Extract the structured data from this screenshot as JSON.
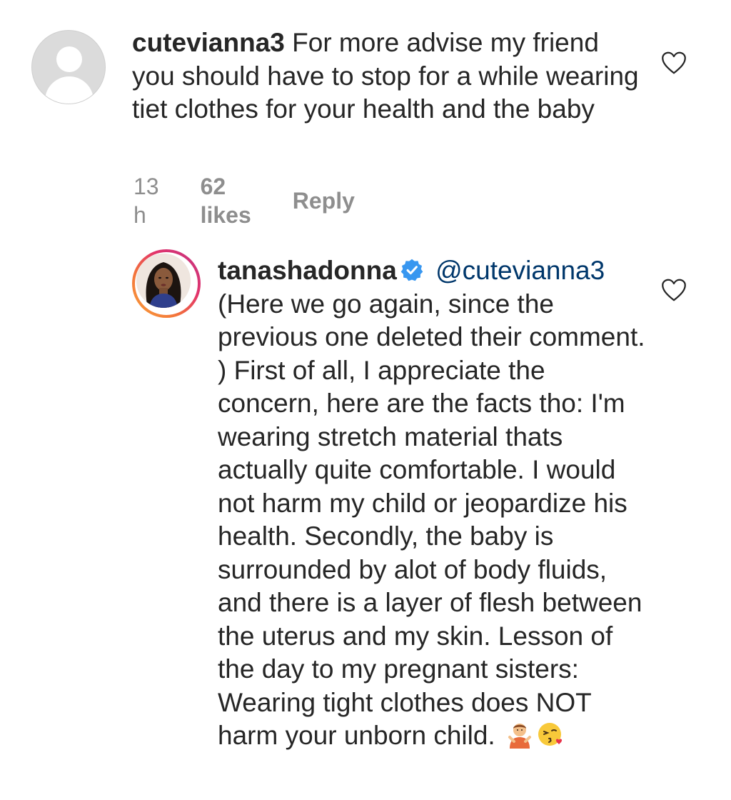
{
  "comments": [
    {
      "username": "cutevianna3",
      "text": "For more advise my friend you should have to stop for a while wearing tiet clothes for your health and the baby",
      "time": "13 h",
      "likes": "62 likes",
      "reply_label": "Reply"
    },
    {
      "username": "tanashadonna",
      "verified": true,
      "mention": "@cutevianna3",
      "text": "(Here we go again, since the previous one deleted their comment. ) First of all, I appreciate the concern, here are the facts tho: I'm wearing stretch material thats actually quite comfortable. I would not harm my child or jeopardize his health. Secondly, the baby is surrounded by alot of body fluids, and there is a layer of flesh between the uterus and my skin. Lesson of the day to my pregnant sisters: Wearing tight clothes does NOT harm your unborn child.",
      "emojis": [
        "person-gesturing-ok-emoji",
        "face-blowing-kiss-emoji"
      ]
    }
  ],
  "icons": {
    "like": "heart-outline-icon",
    "verified": "verified-badge-icon",
    "default_avatar": "default-avatar-icon"
  },
  "colors": {
    "text": "#262626",
    "meta": "#8e8e8e",
    "mention": "#00376b",
    "verified": "#3897f0"
  }
}
